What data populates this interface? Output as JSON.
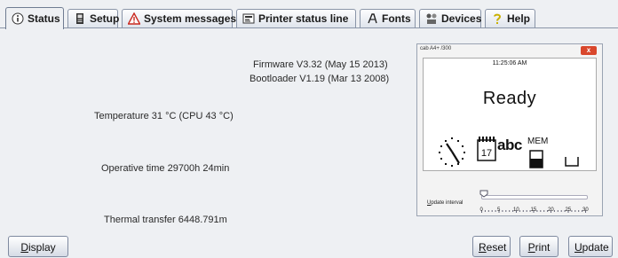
{
  "tabs": [
    {
      "label": "Status",
      "icon": "info-icon"
    },
    {
      "label": "Setup",
      "icon": "printer-icon"
    },
    {
      "label": "System messages",
      "icon": "warning-icon"
    },
    {
      "label": "Printer status line",
      "icon": "status-line-icon"
    },
    {
      "label": "Fonts",
      "icon": "font-icon"
    },
    {
      "label": "Devices",
      "icon": "devices-icon"
    },
    {
      "label": "Help",
      "icon": "help-icon"
    }
  ],
  "status": {
    "firmware": "Firmware V3.32 (May 15 2013)",
    "bootloader": "Bootloader V1.19 (Mar 13 2008)",
    "temperature": "Temperature 31 °C (CPU 43 °C)",
    "operative_time": "Operative time 29700h 24min",
    "thermal_transfer": "Thermal transfer 6448.791m"
  },
  "display_window": {
    "title": "cab A4+ /300",
    "time": "11:25:06 AM",
    "status": "Ready",
    "calendar_day": "17",
    "abc_label": "abc",
    "mem_label": "MEM",
    "update_interval_label": "Update interval",
    "update_interval_mnemonic": "U",
    "update_interval_rest": "pdate interval",
    "slider_ticks": [
      "0",
      "5",
      "10",
      "15",
      "20",
      "25",
      "30"
    ],
    "slider_value": 0
  },
  "buttons": {
    "display": {
      "mnemonic": "D",
      "rest": "isplay"
    },
    "reset": {
      "mnemonic": "R",
      "rest": "eset"
    },
    "print": {
      "mnemonic": "P",
      "rest": "rint"
    },
    "update": {
      "mnemonic": "U",
      "rest": "pdate"
    }
  },
  "colors": {
    "accent": "#d9472c",
    "panel": "#eef0f3",
    "border": "#8a95a8"
  }
}
